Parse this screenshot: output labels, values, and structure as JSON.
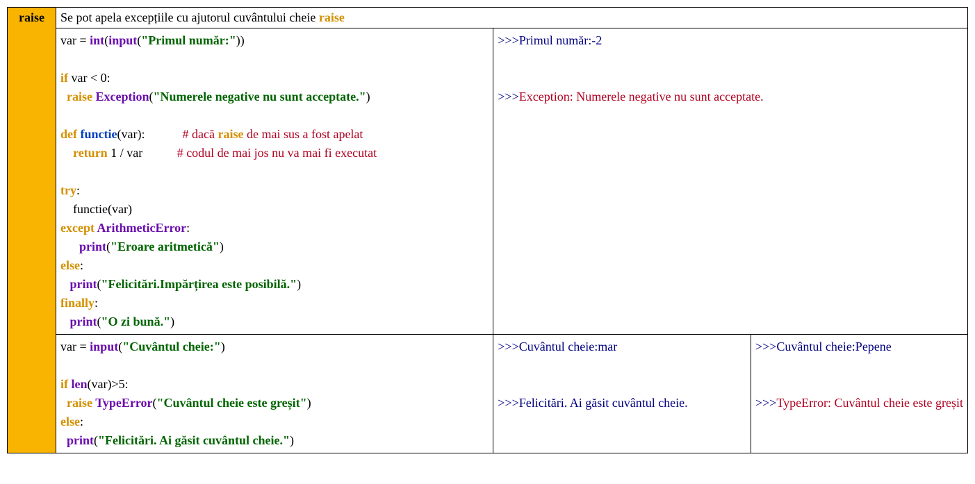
{
  "row_label": "raise",
  "intro": {
    "text": "Se pot apela excepțiile cu ajutorul cuvântului cheie ",
    "keyword": "raise"
  },
  "ex1": {
    "code": {
      "l1_a": "var = ",
      "l1_b": "int",
      "l1_c": "(",
      "l1_d": "input",
      "l1_e": "(",
      "l1_f": "\"Primul număr:\"",
      "l1_g": "))",
      "l3_a": "if",
      "l3_b": " var < 0:",
      "l4_a": "  raise",
      "l4_b": " Exception",
      "l4_c": "(",
      "l4_d": "\"Numerele negative nu sunt acceptate.\"",
      "l4_e": ")",
      "l6_a": "def",
      "l6_b": " functie",
      "l6_c": "(var):            ",
      "l6_d": "# dacă ",
      "l6_e": "raise",
      "l6_f": " de mai sus a fost apelat",
      "l7_a": "    return",
      "l7_b": " 1 / var           ",
      "l7_c": "# codul de mai jos nu va mai fi executat",
      "l9_a": "try",
      "l9_b": ":",
      "l10": "    functie(var)",
      "l11_a": "except",
      "l11_b": " ArithmeticError",
      "l11_c": ":",
      "l12_a": "      print",
      "l12_b": "(",
      "l12_c": "\"Eroare aritmetică\"",
      "l12_d": ")",
      "l13_a": "else",
      "l13_b": ":",
      "l14_a": "   print",
      "l14_b": "(",
      "l14_c": "\"Felicitări.Impărțirea este posibilă.\"",
      "l14_d": ")",
      "l15_a": "finally",
      "l15_b": ":",
      "l16_a": "   print",
      "l16_b": "(",
      "l16_c": "\"O zi bună.\"",
      "l16_d": ")"
    },
    "out": {
      "p1": ">>>",
      "t1": "Primul număr:-2",
      "p2": ">>>",
      "t2": "Exception: Numerele negative nu sunt acceptate."
    }
  },
  "ex2": {
    "code": {
      "l1_a": "var = ",
      "l1_b": "input",
      "l1_c": "(",
      "l1_d": "\"Cuvântul cheie:\"",
      "l1_e": ")",
      "l3_a": "if",
      "l3_b": " len",
      "l3_c": "(var)>5:",
      "l4_a": "  raise",
      "l4_b": " TypeError",
      "l4_c": "(",
      "l4_d": "\"Cuvântul cheie este greșit\"",
      "l4_e": ")",
      "l5_a": "else",
      "l5_b": ":",
      "l6_a": "  print",
      "l6_b": "(",
      "l6_c": "\"Felicitări. Ai găsit cuvântul cheie.\"",
      "l6_d": ")"
    },
    "outA": {
      "p1": ">>>",
      "t1": "Cuvântul cheie:mar",
      "p2": ">>>",
      "t2": "Felicitări. Ai găsit cuvântul cheie."
    },
    "outB": {
      "p1": ">>>",
      "t1": "Cuvântul cheie:Pepene",
      "p2": ">>>",
      "t2": "TypeError: Cuvântul cheie este greșit"
    }
  }
}
